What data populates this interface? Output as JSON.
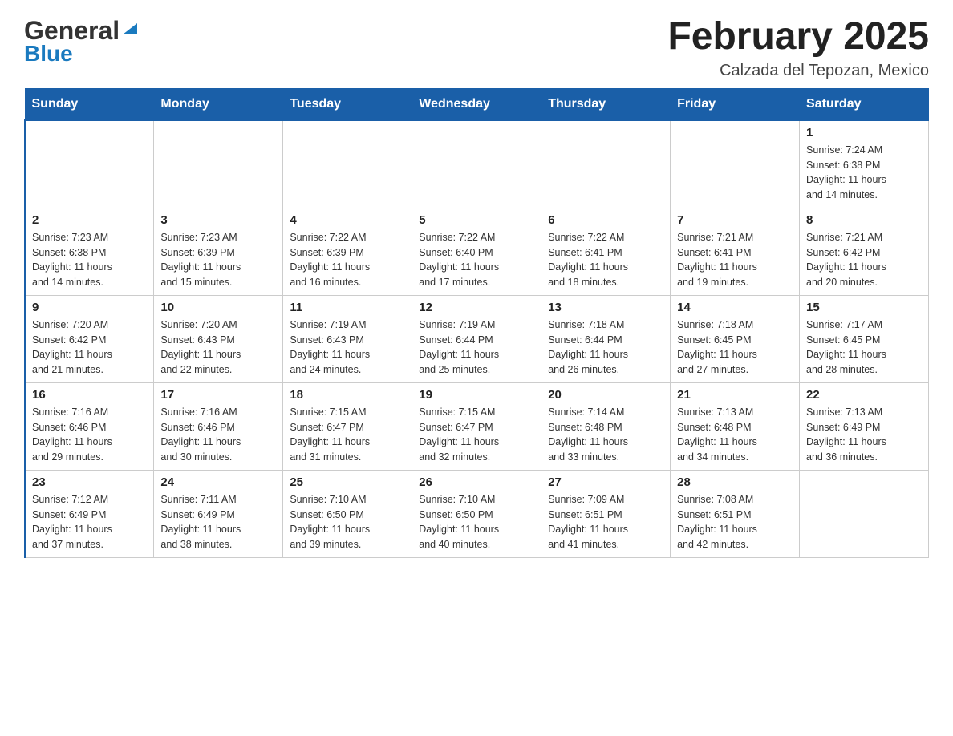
{
  "logo": {
    "line1": "General",
    "line2": "Blue"
  },
  "title": "February 2025",
  "subtitle": "Calzada del Tepozan, Mexico",
  "weekdays": [
    "Sunday",
    "Monday",
    "Tuesday",
    "Wednesday",
    "Thursday",
    "Friday",
    "Saturday"
  ],
  "weeks": [
    [
      {
        "day": "",
        "info": ""
      },
      {
        "day": "",
        "info": ""
      },
      {
        "day": "",
        "info": ""
      },
      {
        "day": "",
        "info": ""
      },
      {
        "day": "",
        "info": ""
      },
      {
        "day": "",
        "info": ""
      },
      {
        "day": "1",
        "info": "Sunrise: 7:24 AM\nSunset: 6:38 PM\nDaylight: 11 hours\nand 14 minutes."
      }
    ],
    [
      {
        "day": "2",
        "info": "Sunrise: 7:23 AM\nSunset: 6:38 PM\nDaylight: 11 hours\nand 14 minutes."
      },
      {
        "day": "3",
        "info": "Sunrise: 7:23 AM\nSunset: 6:39 PM\nDaylight: 11 hours\nand 15 minutes."
      },
      {
        "day": "4",
        "info": "Sunrise: 7:22 AM\nSunset: 6:39 PM\nDaylight: 11 hours\nand 16 minutes."
      },
      {
        "day": "5",
        "info": "Sunrise: 7:22 AM\nSunset: 6:40 PM\nDaylight: 11 hours\nand 17 minutes."
      },
      {
        "day": "6",
        "info": "Sunrise: 7:22 AM\nSunset: 6:41 PM\nDaylight: 11 hours\nand 18 minutes."
      },
      {
        "day": "7",
        "info": "Sunrise: 7:21 AM\nSunset: 6:41 PM\nDaylight: 11 hours\nand 19 minutes."
      },
      {
        "day": "8",
        "info": "Sunrise: 7:21 AM\nSunset: 6:42 PM\nDaylight: 11 hours\nand 20 minutes."
      }
    ],
    [
      {
        "day": "9",
        "info": "Sunrise: 7:20 AM\nSunset: 6:42 PM\nDaylight: 11 hours\nand 21 minutes."
      },
      {
        "day": "10",
        "info": "Sunrise: 7:20 AM\nSunset: 6:43 PM\nDaylight: 11 hours\nand 22 minutes."
      },
      {
        "day": "11",
        "info": "Sunrise: 7:19 AM\nSunset: 6:43 PM\nDaylight: 11 hours\nand 24 minutes."
      },
      {
        "day": "12",
        "info": "Sunrise: 7:19 AM\nSunset: 6:44 PM\nDaylight: 11 hours\nand 25 minutes."
      },
      {
        "day": "13",
        "info": "Sunrise: 7:18 AM\nSunset: 6:44 PM\nDaylight: 11 hours\nand 26 minutes."
      },
      {
        "day": "14",
        "info": "Sunrise: 7:18 AM\nSunset: 6:45 PM\nDaylight: 11 hours\nand 27 minutes."
      },
      {
        "day": "15",
        "info": "Sunrise: 7:17 AM\nSunset: 6:45 PM\nDaylight: 11 hours\nand 28 minutes."
      }
    ],
    [
      {
        "day": "16",
        "info": "Sunrise: 7:16 AM\nSunset: 6:46 PM\nDaylight: 11 hours\nand 29 minutes."
      },
      {
        "day": "17",
        "info": "Sunrise: 7:16 AM\nSunset: 6:46 PM\nDaylight: 11 hours\nand 30 minutes."
      },
      {
        "day": "18",
        "info": "Sunrise: 7:15 AM\nSunset: 6:47 PM\nDaylight: 11 hours\nand 31 minutes."
      },
      {
        "day": "19",
        "info": "Sunrise: 7:15 AM\nSunset: 6:47 PM\nDaylight: 11 hours\nand 32 minutes."
      },
      {
        "day": "20",
        "info": "Sunrise: 7:14 AM\nSunset: 6:48 PM\nDaylight: 11 hours\nand 33 minutes."
      },
      {
        "day": "21",
        "info": "Sunrise: 7:13 AM\nSunset: 6:48 PM\nDaylight: 11 hours\nand 34 minutes."
      },
      {
        "day": "22",
        "info": "Sunrise: 7:13 AM\nSunset: 6:49 PM\nDaylight: 11 hours\nand 36 minutes."
      }
    ],
    [
      {
        "day": "23",
        "info": "Sunrise: 7:12 AM\nSunset: 6:49 PM\nDaylight: 11 hours\nand 37 minutes."
      },
      {
        "day": "24",
        "info": "Sunrise: 7:11 AM\nSunset: 6:49 PM\nDaylight: 11 hours\nand 38 minutes."
      },
      {
        "day": "25",
        "info": "Sunrise: 7:10 AM\nSunset: 6:50 PM\nDaylight: 11 hours\nand 39 minutes."
      },
      {
        "day": "26",
        "info": "Sunrise: 7:10 AM\nSunset: 6:50 PM\nDaylight: 11 hours\nand 40 minutes."
      },
      {
        "day": "27",
        "info": "Sunrise: 7:09 AM\nSunset: 6:51 PM\nDaylight: 11 hours\nand 41 minutes."
      },
      {
        "day": "28",
        "info": "Sunrise: 7:08 AM\nSunset: 6:51 PM\nDaylight: 11 hours\nand 42 minutes."
      },
      {
        "day": "",
        "info": ""
      }
    ]
  ]
}
